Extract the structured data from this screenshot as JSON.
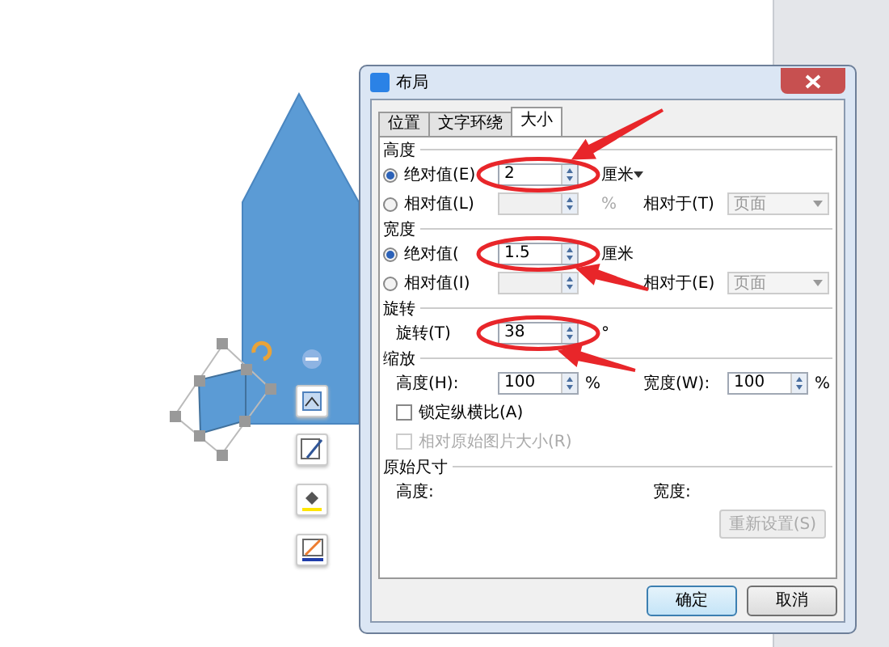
{
  "dialog": {
    "title": "布局",
    "tabs": [
      {
        "label": "位置",
        "selected": false
      },
      {
        "label": "文字环绕",
        "selected": false
      },
      {
        "label": "大小",
        "selected": true
      }
    ],
    "sections": [
      {
        "title": "高度",
        "rows": [
          {
            "kind": "radio",
            "label": "绝对值(E)",
            "selected": true,
            "value": "2",
            "unit": "厘米"
          },
          {
            "kind": "radio",
            "label": "相对值(L)",
            "selected": false,
            "unit": "%",
            "relative_label": "相对于(T)",
            "relative_value": "页面"
          }
        ]
      },
      {
        "title": "宽度",
        "rows": [
          {
            "kind": "radio",
            "label": "绝对值(",
            "selected": true,
            "value": "1.5",
            "unit": "厘米"
          },
          {
            "kind": "radio",
            "label": "相对值(I)",
            "selected": false,
            "relative_label": "相对于(E)",
            "relative_value": "页面"
          }
        ]
      },
      {
        "title": "旋转",
        "rows": [
          {
            "kind": "spin",
            "label": "旋转(T)",
            "value": "38",
            "unit": "°"
          }
        ]
      },
      {
        "title": "缩放",
        "rows": [
          {
            "kind": "spin_pair",
            "label": "高度(H):",
            "value": "100",
            "unit": "%",
            "label2": "宽度(W):",
            "value2": "100",
            "unit2": "%"
          },
          {
            "kind": "checkbox",
            "label": "锁定纵横比(A)",
            "checked": false,
            "disabled": false
          },
          {
            "kind": "checkbox",
            "label": "相对原始图片大小(R)",
            "checked": false,
            "disabled": true
          }
        ]
      },
      {
        "title": "原始尺寸",
        "rows": [
          {
            "kind": "text_pair",
            "label": "高度:",
            "label2": "宽度:"
          },
          {
            "kind": "button",
            "label": "重新设置(S)",
            "disabled": true
          }
        ]
      }
    ],
    "buttons": [
      {
        "label": "确定",
        "default": true
      },
      {
        "label": "取消",
        "default": false
      }
    ]
  }
}
